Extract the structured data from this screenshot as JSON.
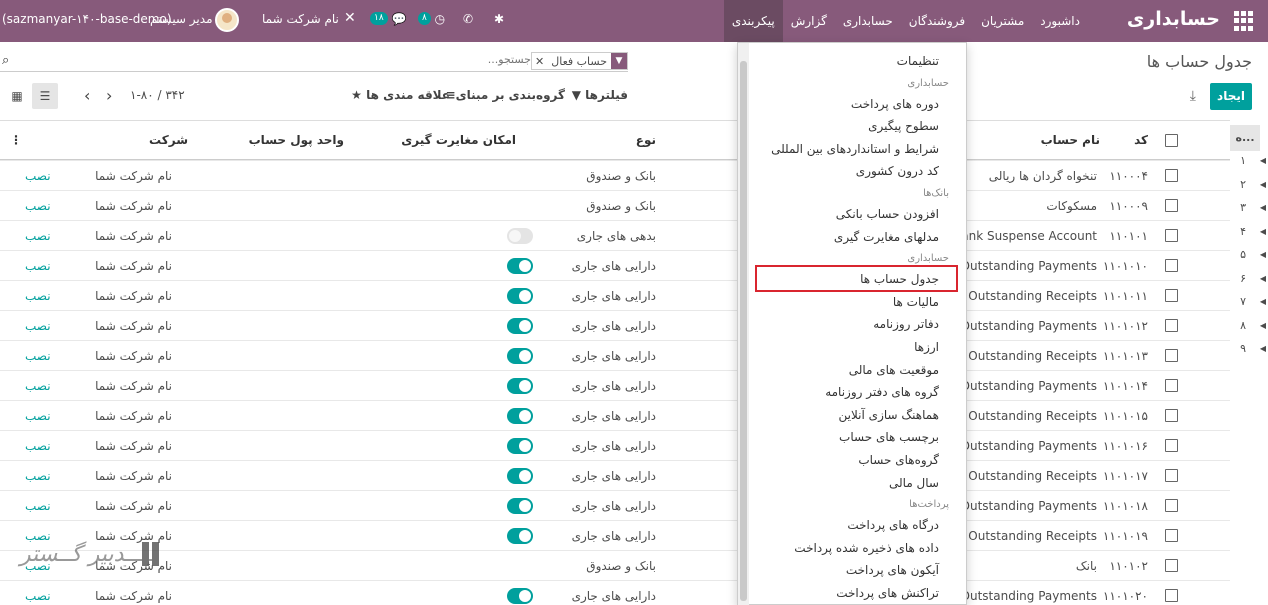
{
  "navbar": {
    "brand": "حسابداری",
    "menu": [
      {
        "label": "داشبورد",
        "active": false
      },
      {
        "label": "مشتریان",
        "active": false
      },
      {
        "label": "فروشندگان",
        "active": false
      },
      {
        "label": "حسابداری",
        "active": false
      },
      {
        "label": "گزارش",
        "active": false
      },
      {
        "label": "پیکربندی",
        "active": true
      }
    ],
    "systray": {
      "db_name": "(sazmanyar-۱۴۰-base-demo)",
      "user_name": "مدیر سیستم",
      "company": "نام شرکت شما",
      "messages_count": "۱۸",
      "activities_count": "۸"
    }
  },
  "control_panel": {
    "title": "جدول حساب ها",
    "create_label": "ایجاد",
    "search": {
      "facet_value": "حساب فعال",
      "placeholder": "جستجو..."
    },
    "filters_label": "فیلترها",
    "groupby_label": "گروه‌بندی بر مبنای",
    "favorites_label": "علاقه مندی ها",
    "pager_value": "۱-۸۰ / ۳۴۲"
  },
  "table": {
    "headers": {
      "code": "کد",
      "name": "نام حساب",
      "type": "نوع",
      "reconcile": "امکان مغایرت گیری",
      "currency": "واحد پول حساب",
      "company": "شرکت"
    },
    "rows": [
      {
        "code": "۱۱۰۰۰۴",
        "name": "تنخواه گردان ها ریالی",
        "type": "بانک و صندوق",
        "toggle": "none",
        "company": "نام شرکت شما",
        "action": "نصب"
      },
      {
        "code": "۱۱۰۰۰۹",
        "name": "مسکوکات",
        "type": "بانک و صندوق",
        "toggle": "none",
        "company": "نام شرکت شما",
        "action": "نصب"
      },
      {
        "code": "۱۱۰۱۰۱",
        "name": "Bank Suspense Account",
        "type": "بدهی های جاری",
        "toggle": "off",
        "company": "نام شرکت شما",
        "action": "نصب"
      },
      {
        "code": "۱۱۰۱۰۱۰",
        "name": "Outstanding Payments",
        "type": "دارایی های جاری",
        "toggle": "on",
        "company": "نام شرکت شما",
        "action": "نصب"
      },
      {
        "code": "۱۱۰۱۰۱۱",
        "name": "Outstanding Receipts",
        "type": "دارایی های جاری",
        "toggle": "on",
        "company": "نام شرکت شما",
        "action": "نصب"
      },
      {
        "code": "۱۱۰۱۰۱۲",
        "name": "Outstanding Payments",
        "type": "دارایی های جاری",
        "toggle": "on",
        "company": "نام شرکت شما",
        "action": "نصب"
      },
      {
        "code": "۱۱۰۱۰۱۳",
        "name": "Outstanding Receipts",
        "type": "دارایی های جاری",
        "toggle": "on",
        "company": "نام شرکت شما",
        "action": "نصب"
      },
      {
        "code": "۱۱۰۱۰۱۴",
        "name": "Outstanding Payments",
        "type": "دارایی های جاری",
        "toggle": "on",
        "company": "نام شرکت شما",
        "action": "نصب"
      },
      {
        "code": "۱۱۰۱۰۱۵",
        "name": "Outstanding Receipts",
        "type": "دارایی های جاری",
        "toggle": "on",
        "company": "نام شرکت شما",
        "action": "نصب"
      },
      {
        "code": "۱۱۰۱۰۱۶",
        "name": "Outstanding Payments",
        "type": "دارایی های جاری",
        "toggle": "on",
        "company": "نام شرکت شما",
        "action": "نصب"
      },
      {
        "code": "۱۱۰۱۰۱۷",
        "name": "Outstanding Receipts",
        "type": "دارایی های جاری",
        "toggle": "on",
        "company": "نام شرکت شما",
        "action": "نصب"
      },
      {
        "code": "۱۱۰۱۰۱۸",
        "name": "Outstanding Payments",
        "type": "دارایی های جاری",
        "toggle": "on",
        "company": "نام شرکت شما",
        "action": "نصب"
      },
      {
        "code": "۱۱۰۱۰۱۹",
        "name": "Outstanding Receipts",
        "type": "دارایی های جاری",
        "toggle": "on",
        "company": "نام شرکت شما",
        "action": "نصب"
      },
      {
        "code": "۱۱۰۱۰۲",
        "name": "بانک",
        "type": "بانک و صندوق",
        "toggle": "none",
        "company": "نام شرکت شما",
        "action": "نصب"
      },
      {
        "code": "۱۱۰۱۰۲۰",
        "name": "Outstanding Payments",
        "type": "دارایی های جاری",
        "toggle": "on",
        "company": "نام شرکت شما",
        "action": "نصب"
      }
    ]
  },
  "side_panel": {
    "header": "ه...",
    "numbers": [
      "۱",
      "۲",
      "۳",
      "۴",
      "۵",
      "۶",
      "۷",
      "۸",
      "۹"
    ]
  },
  "dropdown": {
    "entries": [
      {
        "kind": "item",
        "label": "تنظیمات"
      },
      {
        "kind": "header",
        "label": "حسابداری"
      },
      {
        "kind": "item",
        "label": "دوره های پرداخت"
      },
      {
        "kind": "item",
        "label": "سطوح پیگیری"
      },
      {
        "kind": "item",
        "label": "شرایط و استانداردهای بین المللی"
      },
      {
        "kind": "item",
        "label": "کد درون کشوری"
      },
      {
        "kind": "header",
        "label": "بانک‌ها"
      },
      {
        "kind": "item",
        "label": "افزودن حساب بانکی"
      },
      {
        "kind": "item",
        "label": "مدلهای مغایرت گیری"
      },
      {
        "kind": "header",
        "label": "حسابداری"
      },
      {
        "kind": "item",
        "label": "جدول حساب ها",
        "highlighted": true
      },
      {
        "kind": "item",
        "label": "مالیات ها"
      },
      {
        "kind": "item",
        "label": "دفاتر روزنامه"
      },
      {
        "kind": "item",
        "label": "ارزها"
      },
      {
        "kind": "item",
        "label": "موقعیت های مالی"
      },
      {
        "kind": "item",
        "label": "گروه های دفتر روزنامه"
      },
      {
        "kind": "item",
        "label": "هماهنگ سازی آنلاین"
      },
      {
        "kind": "item",
        "label": "برچسب های حساب"
      },
      {
        "kind": "item",
        "label": "گروه‌های حساب"
      },
      {
        "kind": "item",
        "label": "سال مالی"
      },
      {
        "kind": "header",
        "label": "پرداخت‌ها"
      },
      {
        "kind": "item",
        "label": "درگاه های پرداخت"
      },
      {
        "kind": "item",
        "label": "داده های ذخیره شده پرداخت"
      },
      {
        "kind": "item",
        "label": "آیکون های پرداخت"
      },
      {
        "kind": "item",
        "label": "تراکنش های پرداخت"
      }
    ]
  },
  "watermark": {
    "text": "تــــدبیر گــستر"
  },
  "colors": {
    "brand": "#875a7b",
    "accent": "#00a09d",
    "highlight": "#d9252f"
  }
}
